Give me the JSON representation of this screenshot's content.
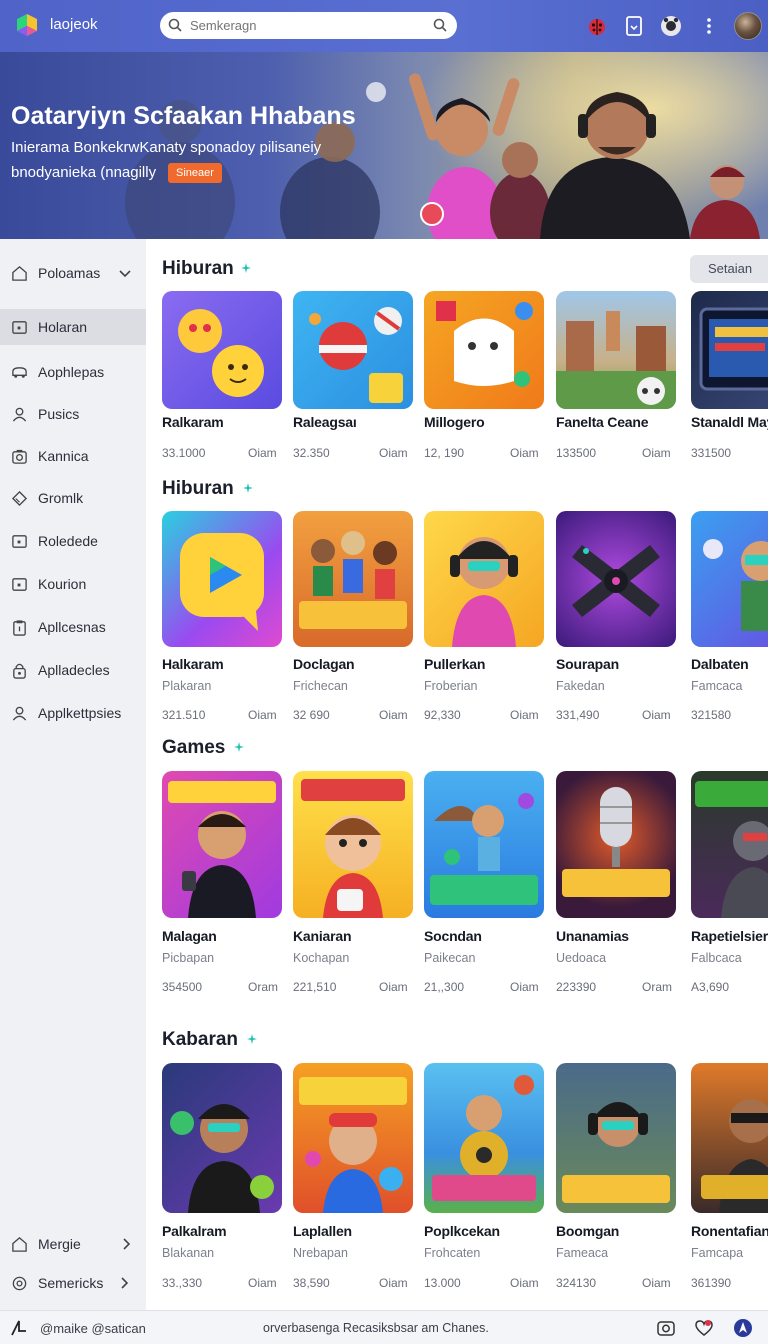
{
  "header": {
    "app_name": "laojeok",
    "search_placeholder": "Semkeragn",
    "icons": [
      "ladybug-icon",
      "bookmark-icon",
      "controller-icon",
      "more-vertical-icon"
    ],
    "colors": {
      "bar": "#5266cc",
      "accent": "#1cc2b0"
    }
  },
  "hero": {
    "title": "Oataryiyn Scfaakan Hhabans",
    "line1": "Inierama BonkekrwKanaty sponadoy pilisaneiy",
    "line2": "bnodyanieka (nnagilly",
    "badge": "Sineaer"
  },
  "sidebar": {
    "items": [
      {
        "label": "Poloamas",
        "icon": "home-icon",
        "chevron": "down"
      },
      {
        "label": "Holaran",
        "icon": "square-icon"
      },
      {
        "label": "Aophlepas",
        "icon": "car-icon"
      },
      {
        "label": "Pusics",
        "icon": "user-icon"
      },
      {
        "label": "Kannica",
        "icon": "camera-icon"
      },
      {
        "label": "Gromlk",
        "icon": "diamond-icon"
      },
      {
        "label": "Roledede",
        "icon": "square-icon"
      },
      {
        "label": "Kourion",
        "icon": "square-icon"
      },
      {
        "label": "Apllcesnas",
        "icon": "clipboard-icon"
      },
      {
        "label": "Aplladecles",
        "icon": "lock-icon"
      },
      {
        "label": "Applkettpsies",
        "icon": "user-icon"
      }
    ],
    "bottom": [
      {
        "label": "Mergie",
        "icon": "home-icon"
      },
      {
        "label": "Semericks",
        "icon": "settings-icon"
      }
    ]
  },
  "main": {
    "filter_label": "Setaian",
    "sections": [
      {
        "title": "Hiburan",
        "cards": [
          {
            "name": "Ralkaram",
            "num": "33.1000",
            "unit": "Oiam"
          },
          {
            "name": "Raleagsaı",
            "num": "32.350",
            "unit": "Oiam"
          },
          {
            "name": "Millogero",
            "num": "12, 190",
            "unit": "Oiam"
          },
          {
            "name": "Fanelta Ceane",
            "num": "133500",
            "unit": "Oiam"
          },
          {
            "name": "Stanaldl May",
            "num": "331500",
            "unit": ""
          }
        ]
      },
      {
        "title": "Hiburan",
        "cards": [
          {
            "name": "Halkaram",
            "sub": "Plakaran",
            "num": "321.510",
            "unit": "Oiam"
          },
          {
            "name": "Doclagan",
            "sub": "Frichecan",
            "num": "32 690",
            "unit": "Oiam"
          },
          {
            "name": "Pullerkan",
            "sub": "Froberian",
            "num": "92,330",
            "unit": "Oiam"
          },
          {
            "name": "Sourapan",
            "sub": "Fakedan",
            "num": "331,490",
            "unit": "Oiam"
          },
          {
            "name": "Dalbaten",
            "sub": "Famcaca",
            "num": "321580",
            "unit": ""
          }
        ]
      },
      {
        "title": "Games",
        "cards": [
          {
            "name": "Malagan",
            "sub": "Picbapan",
            "num": "354500",
            "unit": "Oram"
          },
          {
            "name": "Kaniaran",
            "sub": "Kochapan",
            "num": "221,510",
            "unit": "Oiam"
          },
          {
            "name": "Socndan",
            "sub": "Paikecan",
            "num": "21,,300",
            "unit": "Oiam"
          },
          {
            "name": "Unanamias",
            "sub": "Uedoaca",
            "num": "223390",
            "unit": "Oram"
          },
          {
            "name": "Rapetielsier",
            "sub": "Falbcaca",
            "num": "A3,690",
            "unit": ""
          }
        ]
      },
      {
        "title": "Kabaran",
        "cards": [
          {
            "name": "Palkalram",
            "sub": "Blakanan",
            "num": "33.,330",
            "unit": "Oiam"
          },
          {
            "name": "Laplallen",
            "sub": "Nrebapan",
            "num": "38,590",
            "unit": "Oiam"
          },
          {
            "name": "Poplkcekan",
            "sub": "Frohcaten",
            "num": "13.000",
            "unit": "Oiam"
          },
          {
            "name": "Boomgan",
            "sub": "Fameaca",
            "num": "324130",
            "unit": "Oiam"
          },
          {
            "name": "Ronentafian",
            "sub": "Famcapa",
            "num": "361390",
            "unit": ""
          }
        ]
      }
    ]
  },
  "footer": {
    "left": "@maike @satican",
    "mid": "orverbasenga Recasiksbsar am Chanes."
  }
}
